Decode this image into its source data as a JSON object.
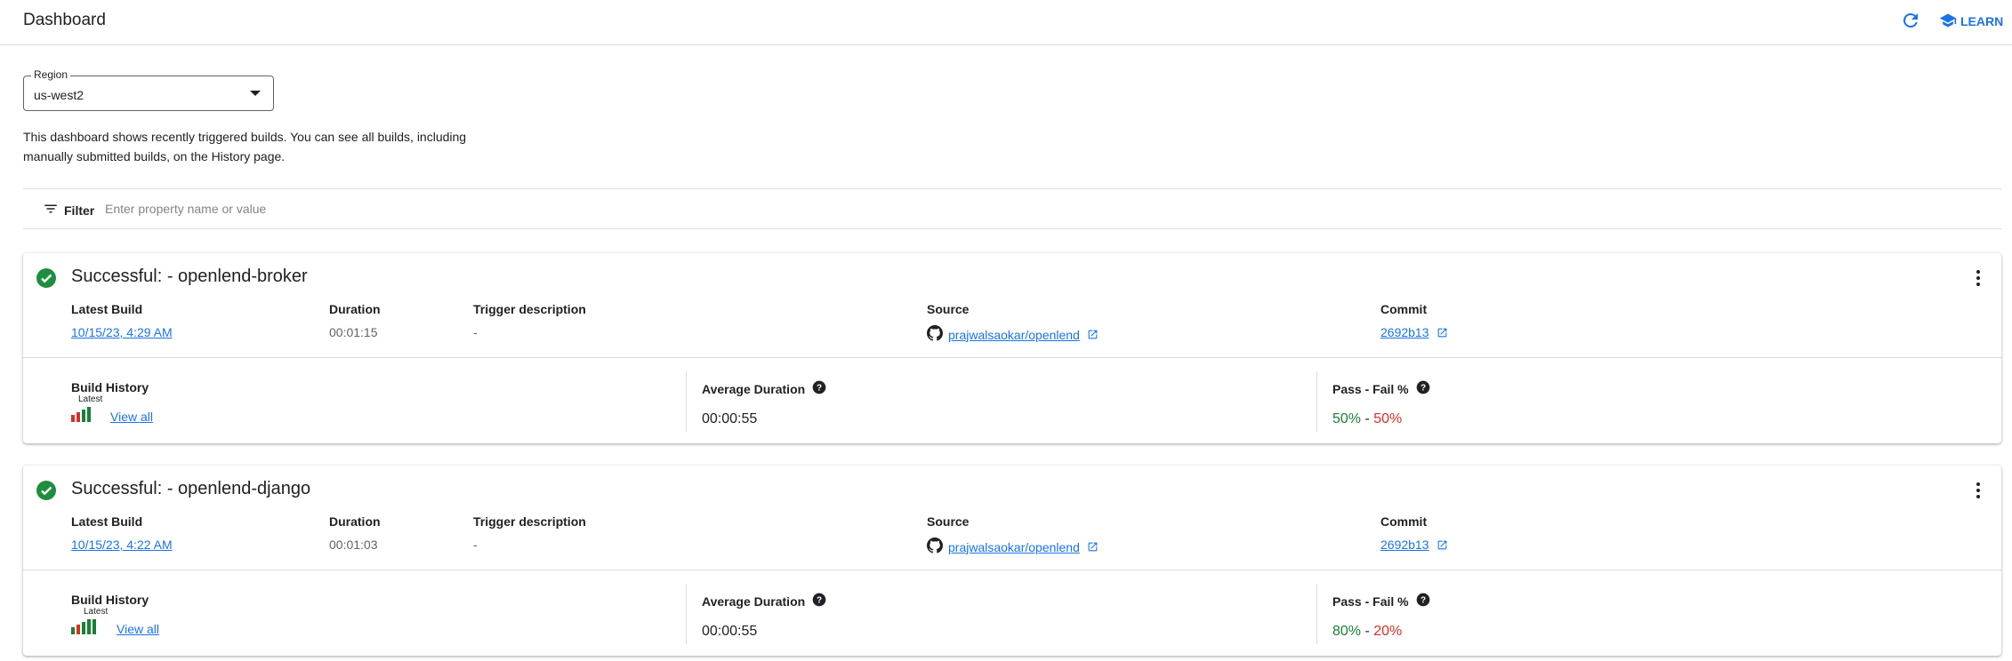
{
  "header": {
    "title": "Dashboard",
    "learn_label": "LEARN",
    "refresh_icon": "refresh-icon",
    "learn_icon": "school-icon"
  },
  "region": {
    "label": "Region",
    "value": "us-west2"
  },
  "description": "This dashboard shows recently triggered builds. You can see all builds, including manually submitted builds, on the History page.",
  "filter": {
    "label": "Filter",
    "placeholder": "Enter property name or value"
  },
  "columns": {
    "latest_build": "Latest Build",
    "duration": "Duration",
    "trigger": "Trigger description",
    "source": "Source",
    "commit": "Commit"
  },
  "sections": {
    "history": "Build History",
    "avg": "Average Duration",
    "passfail": "Pass - Fail %",
    "latest": "Latest",
    "view_all": "View all"
  },
  "colors": {
    "accent": "#1a73e8",
    "success": "#188038",
    "fail": "#d93025"
  },
  "builds": [
    {
      "title": "Successful: - openlend-broker",
      "latest_build": "10/15/23, 4:29 AM",
      "duration": "00:01:15",
      "trigger": "-",
      "source": "prajwalsaokar/openlend",
      "commit": "2692b13",
      "avg_duration": "00:00:55",
      "pass": "50%",
      "separator": " - ",
      "fail": "50%",
      "history": [
        "fail",
        "fail",
        "success",
        "success"
      ]
    },
    {
      "title": "Successful: - openlend-django",
      "latest_build": "10/15/23, 4:22 AM",
      "duration": "00:01:03",
      "trigger": "-",
      "source": "prajwalsaokar/openlend",
      "commit": "2692b13",
      "avg_duration": "00:00:55",
      "pass": "80%",
      "separator": " - ",
      "fail": "20%",
      "history": [
        "success",
        "fail",
        "success",
        "success",
        "success"
      ]
    }
  ]
}
